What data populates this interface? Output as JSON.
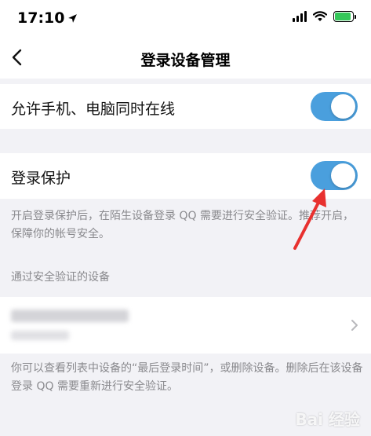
{
  "status_bar": {
    "time": "17:10",
    "icons": [
      "location-arrow-icon",
      "signal-icon",
      "wifi-icon",
      "battery-charging-icon"
    ],
    "battery_color": "#34c759"
  },
  "nav": {
    "title": "登录设备管理",
    "back_icon": "chevron-left-icon"
  },
  "settings": {
    "simultaneous_online": {
      "label": "允许手机、电脑同时在线",
      "enabled": true
    },
    "login_protection": {
      "label": "登录保护",
      "enabled": true,
      "description": "开启登录保护后，在陌生设备登录 QQ 需要进行安全验证。推荐开启，保障你的帐号安全。"
    }
  },
  "verified_devices": {
    "section_title": "通过安全验证的设备",
    "device_name": "",
    "device_model": "",
    "footer_note": "你可以查看列表中设备的“最后登录时间”，或删除设备。删除后在该设备登录 QQ 需要重新进行安全验证。"
  },
  "watermark": "Bai 经验",
  "colors": {
    "toggle_on": "#4a9fdd",
    "annotation_arrow": "#e8312f",
    "background": "#f2f2f6"
  }
}
